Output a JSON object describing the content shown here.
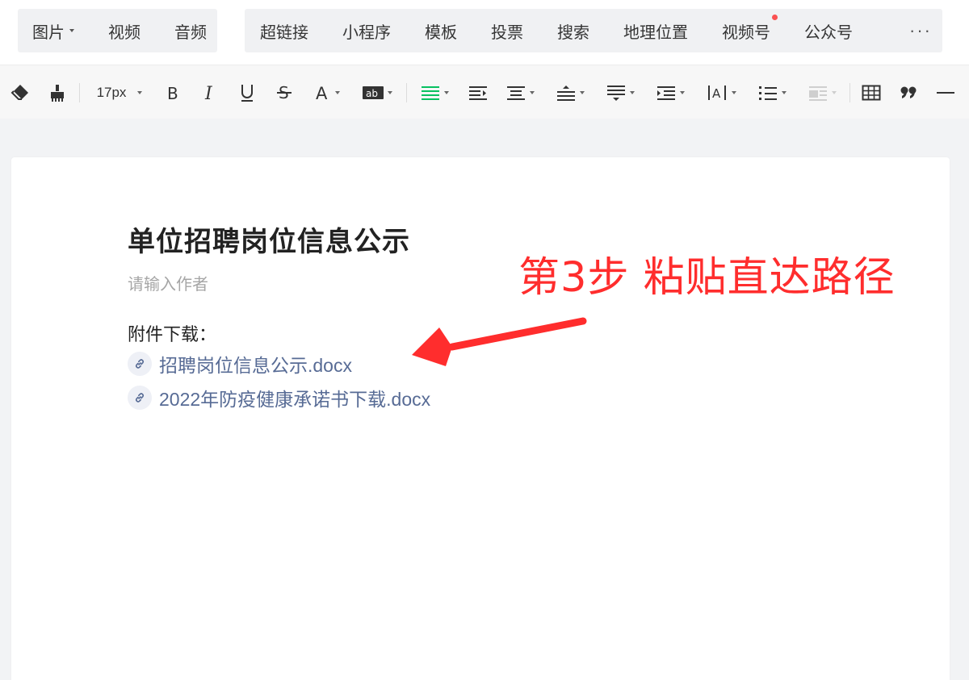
{
  "insert_bar": {
    "group1": [
      {
        "label": "图片",
        "has_dropdown": true
      },
      {
        "label": "视频"
      },
      {
        "label": "音频"
      }
    ],
    "group2": [
      {
        "label": "超链接"
      },
      {
        "label": "小程序"
      },
      {
        "label": "模板"
      },
      {
        "label": "投票"
      },
      {
        "label": "搜索"
      },
      {
        "label": "地理位置"
      },
      {
        "label": "视频号",
        "has_notification_dot": true
      },
      {
        "label": "公众号"
      }
    ],
    "more_label": "···"
  },
  "format_toolbar": {
    "font_size": "17px",
    "buttons": [
      "eraser-icon",
      "format-painter-icon",
      "bold-icon",
      "italic-icon",
      "underline-icon",
      "strikethrough-icon",
      "font-color-icon",
      "background-color-icon",
      "align-justify-icon",
      "indent-icon",
      "align-center-icon",
      "line-height-icon",
      "paragraph-spacing-icon",
      "first-line-indent-icon",
      "letter-spacing-icon",
      "list-icon",
      "float-icon",
      "table-icon",
      "quote-icon",
      "divider-icon"
    ],
    "active_color": "#07c160"
  },
  "editor": {
    "title": "单位招聘岗位信息公示",
    "author_placeholder": "请输入作者",
    "attachments_heading": "附件下载：",
    "attachments": [
      {
        "label": "招聘岗位信息公示.docx"
      },
      {
        "label": "2022年防疫健康承诺书下载.docx"
      }
    ],
    "link_color": "#576b95"
  },
  "annotation": {
    "text": "第3步 粘贴直达路径",
    "color": "#ff2d2d"
  }
}
